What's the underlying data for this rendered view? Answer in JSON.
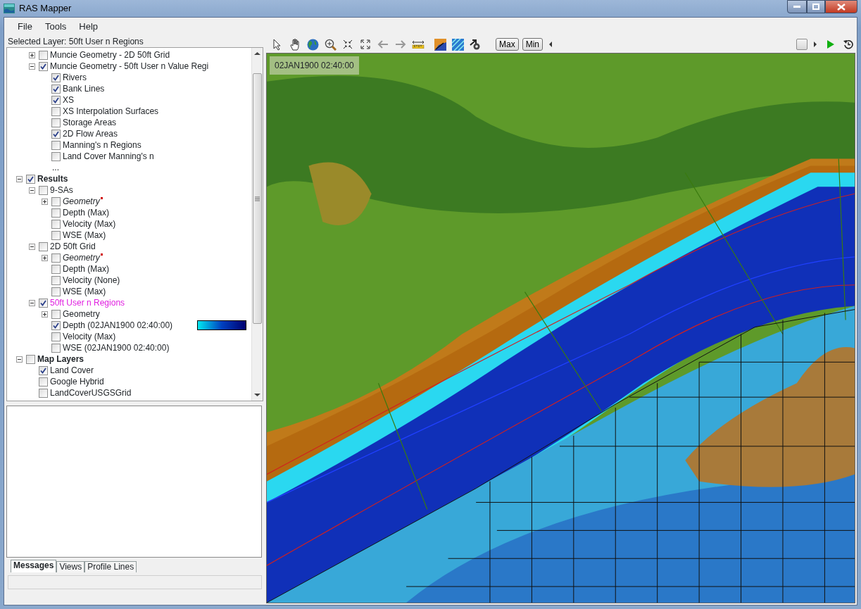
{
  "window": {
    "title": "RAS Mapper"
  },
  "menu": [
    "File",
    "Tools",
    "Help"
  ],
  "selected_layer": "Selected Layer: 50ft User n Regions",
  "tree": {
    "items": [
      {
        "kind": "hidden",
        "children": [
          {
            "kind": "layer",
            "label": "Muncie Geometry - 2D 50ft Grid",
            "checked": false,
            "selected": false,
            "expanded": false
          },
          {
            "kind": "layer",
            "label": "Muncie Geometry - 50ft User n Value Regi",
            "checked": true,
            "selected": false,
            "expanded": true,
            "children": [
              {
                "kind": "layer",
                "label": "Rivers",
                "checked": true,
                "selected": false
              },
              {
                "kind": "layer",
                "label": "Bank Lines",
                "checked": true,
                "selected": false
              },
              {
                "kind": "layer",
                "label": "XS",
                "checked": true,
                "selected": false
              },
              {
                "kind": "layer",
                "label": "XS Interpolation Surfaces",
                "checked": false,
                "selected": false
              },
              {
                "kind": "layer",
                "label": "Storage Areas",
                "checked": false,
                "selected": false
              },
              {
                "kind": "layer",
                "label": "2D Flow Areas",
                "checked": true,
                "selected": false
              },
              {
                "kind": "layer",
                "label": "Manning's n Regions",
                "checked": false,
                "selected": false
              },
              {
                "kind": "layer",
                "label": "Land Cover Manning's n",
                "checked": false,
                "selected": false
              },
              {
                "kind": "more",
                "label": "...",
                "selected": false
              }
            ]
          }
        ]
      },
      {
        "kind": "group",
        "label": "Results",
        "checked": true,
        "selected": false,
        "expanded": true,
        "children": [
          {
            "kind": "layer",
            "label": "9-SAs",
            "checked": false,
            "selected": false,
            "expanded": true,
            "children": [
              {
                "kind": "geometry",
                "label": "Geometry",
                "checked": false,
                "selected": false,
                "expanded": false
              },
              {
                "kind": "layer",
                "label": "Depth (Max)",
                "checked": false,
                "selected": false
              },
              {
                "kind": "layer",
                "label": "Velocity (Max)",
                "checked": false,
                "selected": false
              },
              {
                "kind": "layer",
                "label": "WSE (Max)",
                "checked": false,
                "selected": false
              }
            ]
          },
          {
            "kind": "layer",
            "label": "2D 50ft Grid",
            "checked": false,
            "selected": false,
            "expanded": true,
            "children": [
              {
                "kind": "geometry",
                "label": "Geometry",
                "checked": false,
                "selected": false,
                "expanded": false
              },
              {
                "kind": "layer",
                "label": "Depth (Max)",
                "checked": false,
                "selected": false
              },
              {
                "kind": "layer",
                "label": "Velocity (None)",
                "checked": false,
                "selected": false
              },
              {
                "kind": "layer",
                "label": "WSE (Max)",
                "checked": false,
                "selected": false
              }
            ]
          },
          {
            "kind": "layer",
            "label": "50ft User n Regions",
            "checked": true,
            "selected": true,
            "expanded": true,
            "children": [
              {
                "kind": "layer",
                "label": "Geometry",
                "checked": false,
                "selected": false,
                "expanded": false
              },
              {
                "kind": "legend_layer",
                "label": "Depth (02JAN1900 02:40:00)",
                "checked": true,
                "selected": false
              },
              {
                "kind": "layer",
                "label": "Velocity (Max)",
                "checked": false,
                "selected": false
              },
              {
                "kind": "layer",
                "label": "WSE (02JAN1900 02:40:00)",
                "checked": false,
                "selected": false
              }
            ]
          }
        ]
      },
      {
        "kind": "group",
        "label": "Map Layers",
        "checked": false,
        "selected": false,
        "expanded": true,
        "children": [
          {
            "kind": "layer",
            "label": "Land Cover",
            "checked": true,
            "selected": false
          },
          {
            "kind": "layer",
            "label": "Google Hybrid",
            "checked": false,
            "selected": false
          },
          {
            "kind": "layer",
            "label": "LandCoverUSGSGrid",
            "checked": false,
            "selected": false
          }
        ]
      }
    ]
  },
  "bottom_tabs": [
    {
      "label": "Messages",
      "selected": true
    },
    {
      "label": "Views",
      "selected": false
    },
    {
      "label": "Profile Lines",
      "selected": false
    }
  ],
  "toolbar": {
    "buttons": [
      "Max",
      "Min"
    ],
    "time_slider": {
      "level": 0.985
    }
  },
  "map": {
    "timestamp": "02JAN1900 02:40:00"
  }
}
